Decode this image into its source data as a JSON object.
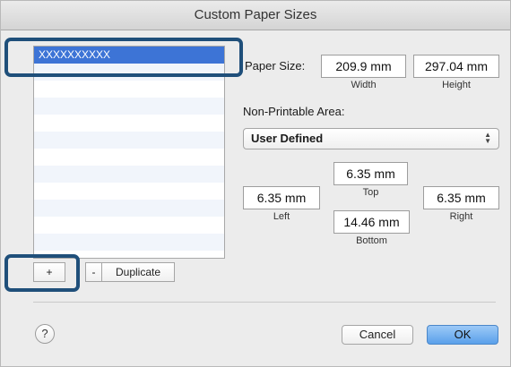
{
  "window": {
    "title": "Custom Paper Sizes"
  },
  "list": {
    "items": [
      "XXXXXXXXXX",
      "",
      "",
      "",
      "",
      "",
      "",
      "",
      "",
      "",
      "",
      ""
    ],
    "selected_index": 0
  },
  "list_buttons": {
    "add": "+",
    "remove": "-",
    "duplicate": "Duplicate"
  },
  "paper_size": {
    "label": "Paper Size:",
    "width_value": "209.9 mm",
    "width_label": "Width",
    "height_value": "297.04 mm",
    "height_label": "Height"
  },
  "non_printable": {
    "label": "Non-Printable Area:",
    "selected": "User Defined",
    "top_value": "6.35 mm",
    "top_label": "Top",
    "left_value": "6.35 mm",
    "left_label": "Left",
    "right_value": "6.35 mm",
    "right_label": "Right",
    "bottom_value": "14.46 mm",
    "bottom_label": "Bottom"
  },
  "footer": {
    "help": "?",
    "cancel": "Cancel",
    "ok": "OK"
  },
  "colors": {
    "selection": "#3d74d6",
    "highlight": "#1f4f7a",
    "ok_button": "#5aa0ea"
  }
}
